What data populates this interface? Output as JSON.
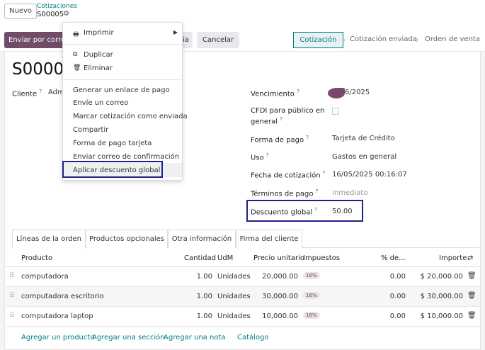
{
  "topbar": {
    "new_label": "Nuevo",
    "breadcrumb_parent": "Cotizaciones",
    "breadcrumb_current": "S00005",
    "gear_glyph": "⚙"
  },
  "actions": {
    "send_email": "Enviar por correo",
    "partial_hidden": "ia",
    "cancel": "Cancelar"
  },
  "statusbar": {
    "steps": [
      "Cotización",
      "Cotización enviada",
      "Orden de venta"
    ],
    "active": "Cotización"
  },
  "record": {
    "title": "S00005",
    "cliente_label": "Cliente",
    "cliente_value": "Adm",
    "help_mark": "?"
  },
  "fields": {
    "vencimiento": {
      "label": "Vencimiento",
      "value": "6/2025"
    },
    "cfdi": {
      "label_line1": "CFDI para público en",
      "label_line2": "general"
    },
    "forma_pago": {
      "label": "Forma de pago",
      "value": "Tarjeta de Crédito"
    },
    "uso": {
      "label": "Uso",
      "value": "Gastos en general"
    },
    "fecha": {
      "label": "Fecha de cotización",
      "value": "16/05/2025 00:16:07"
    },
    "terminos": {
      "label": "Términos de pago",
      "value": "Inmediato"
    },
    "descuento": {
      "label": "Descuento global",
      "value": "50.00"
    }
  },
  "tabs": [
    "Líneas de la orden",
    "Productos opcionales",
    "Otra información",
    "Firma del cliente"
  ],
  "table": {
    "headers": {
      "producto": "Producto",
      "cantidad": "Cantidad",
      "udm": "UdM",
      "precio": "Precio unitario",
      "impuestos": "Impuestos",
      "desc": "% de...",
      "importe": "Importe"
    },
    "rows": [
      {
        "producto": "computadora",
        "cantidad": "1.00",
        "udm": "Unidades",
        "precio": "20,000.00",
        "impuesto": "16%",
        "desc": "0.00",
        "importe": "$ 20,000.00"
      },
      {
        "producto": "computadora escritorio",
        "cantidad": "1.00",
        "udm": "Unidades",
        "precio": "30,000.00",
        "impuesto": "16%",
        "desc": "0.00",
        "importe": "$ 30,000.00"
      },
      {
        "producto": "computadora laptop",
        "cantidad": "1.00",
        "udm": "Unidades",
        "precio": "10,000.00",
        "impuesto": "16%",
        "desc": "0.00",
        "importe": "$ 10,000.00"
      }
    ],
    "links": [
      "Agregar un producto",
      "Agregar una sección",
      "Agregar una nota",
      "Catálogo"
    ]
  },
  "menu": {
    "print": "Imprimir",
    "duplicate": "Duplicar",
    "delete": "Eliminar",
    "items": [
      "Generar un enlace de pago",
      "Envíe un correo",
      "Marcar cotización como enviada",
      "Compartir",
      "Forma de pago tarjeta",
      "Enviar correo de confirmación",
      "Aplicar descuento global"
    ]
  },
  "colors": {
    "primary": "#714b67",
    "accent": "#017e84",
    "highlight_border": "#1f1f8f"
  }
}
